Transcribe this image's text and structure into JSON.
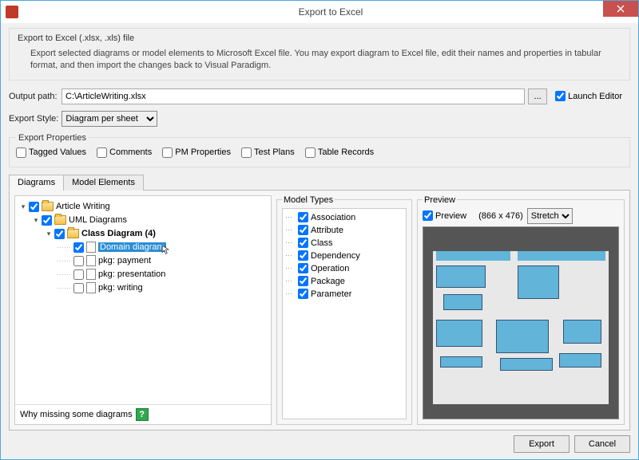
{
  "window": {
    "title": "Export to Excel"
  },
  "intro": {
    "header": "Export to Excel (.xlsx, .xls) file",
    "description": "Export selected diagrams or model elements to Microsoft Excel file. You may export diagram to Excel file, edit their names and properties in tabular format, and then import the changes back to Visual Paradigm."
  },
  "outputPath": {
    "label": "Output path:",
    "value": "C:\\ArticleWriting.xlsx",
    "browse": "..."
  },
  "launchEditor": {
    "label": "Launch Editor",
    "checked": true
  },
  "exportStyle": {
    "label": "Export Style:",
    "value": "Diagram per sheet"
  },
  "exportProperties": {
    "legend": "Export Properties",
    "items": [
      {
        "label": "Tagged Values",
        "checked": false
      },
      {
        "label": "Comments",
        "checked": false
      },
      {
        "label": "PM Properties",
        "checked": false
      },
      {
        "label": "Test Plans",
        "checked": false
      },
      {
        "label": "Table Records",
        "checked": false
      }
    ]
  },
  "tabs": {
    "diagrams": "Diagrams",
    "modelElements": "Model Elements",
    "active": "diagrams"
  },
  "tree": {
    "root": {
      "label": "Article Writing",
      "checked": true
    },
    "uml": {
      "label": "UML Diagrams",
      "checked": true
    },
    "class": {
      "label": "Class Diagram (4)",
      "checked": true
    },
    "items": [
      {
        "label": "Domain diagram",
        "checked": true,
        "selected": true
      },
      {
        "label": "pkg: payment",
        "checked": false
      },
      {
        "label": "pkg: presentation",
        "checked": false
      },
      {
        "label": "pkg: writing",
        "checked": false
      }
    ],
    "footer": "Why missing some diagrams"
  },
  "modelTypes": {
    "legend": "Model Types",
    "items": [
      "Association",
      "Attribute",
      "Class",
      "Dependency",
      "Operation",
      "Package",
      "Parameter"
    ]
  },
  "preview": {
    "legend": "Preview",
    "checkbox": "Preview",
    "checked": true,
    "dimensions": "(866 x 476)",
    "mode": "Stretch"
  },
  "footer": {
    "export": "Export",
    "cancel": "Cancel"
  }
}
